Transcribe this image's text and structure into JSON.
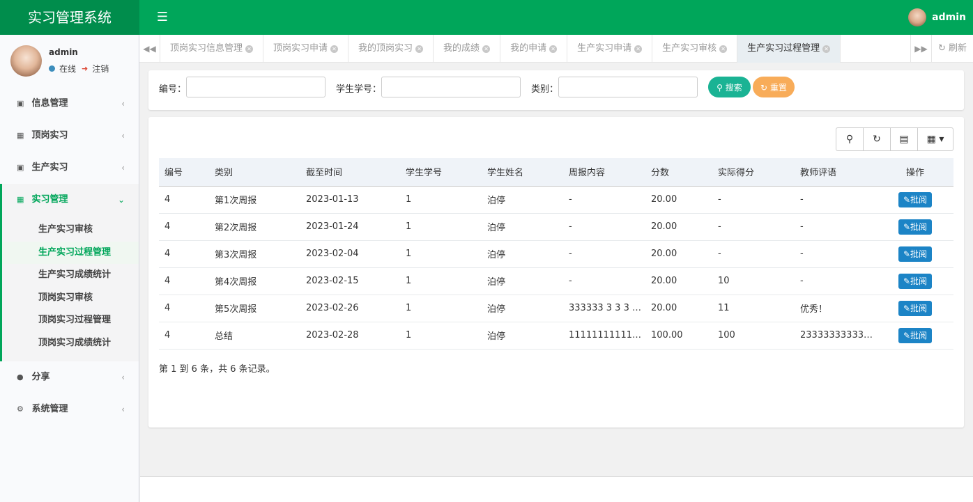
{
  "app": {
    "title": "实习管理系统",
    "user": "admin"
  },
  "sidebar": {
    "user_name": "admin",
    "online_label": "在线",
    "logout_label": "注销",
    "menu": [
      {
        "label": "信息管理",
        "icon": "user-card-icon"
      },
      {
        "label": "顶岗实习",
        "icon": "id-card-icon"
      },
      {
        "label": "生产实习",
        "icon": "user-card-icon"
      },
      {
        "label": "实习管理",
        "icon": "id-card-icon"
      },
      {
        "label": "分享",
        "icon": "comment-icon"
      },
      {
        "label": "系统管理",
        "icon": "gear-icon"
      }
    ],
    "submenu": [
      "生产实习审核",
      "生产实习过程管理",
      "生产实习成绩统计",
      "顶岗实习审核",
      "顶岗实习过程管理",
      "顶岗实习成绩统计"
    ]
  },
  "tabs": [
    "顶岗实习信息管理",
    "顶岗实习申请",
    "我的顶岗实习",
    "我的成绩",
    "我的申请",
    "生产实习申请",
    "生产实习审核",
    "生产实习过程管理"
  ],
  "tab_refresh": "刷新",
  "search": {
    "labels": [
      "编号：",
      "学生学号：",
      "类别："
    ],
    "values": [
      "",
      "",
      ""
    ],
    "search_btn": "搜索",
    "reset_btn": "重置"
  },
  "table": {
    "headers": [
      "编号",
      "类别",
      "截至时间",
      "学生学号",
      "学生姓名",
      "周报内容",
      "分数",
      "实际得分",
      "教师评语",
      "操作"
    ],
    "rows": [
      [
        "4",
        "第1次周报",
        "2023-01-13",
        "1",
        "泊停",
        "-",
        "20.00",
        "-",
        "-"
      ],
      [
        "4",
        "第2次周报",
        "2023-01-24",
        "1",
        "泊停",
        "-",
        "20.00",
        "-",
        "-"
      ],
      [
        "4",
        "第3次周报",
        "2023-02-04",
        "1",
        "泊停",
        "-",
        "20.00",
        "-",
        "-"
      ],
      [
        "4",
        "第4次周报",
        "2023-02-15",
        "1",
        "泊停",
        "-",
        "20.00",
        "10",
        "-"
      ],
      [
        "4",
        "第5次周报",
        "2023-02-26",
        "1",
        "泊停",
        "333333 3 3 3 3...",
        "20.00",
        "11",
        "优秀！"
      ],
      [
        "4",
        "总结",
        "2023-02-28",
        "1",
        "泊停",
        "11111111111111...",
        "100.00",
        "100",
        "233333333333..."
      ]
    ],
    "action_label": "批阅",
    "pager_info": "第 1 到 6 条，共 6 条记录。"
  },
  "colors": {
    "brand": "#00a65a",
    "brand_dark": "#008d4c",
    "search": "#1ab394",
    "reset": "#f8ac59",
    "review": "#1c84c6"
  }
}
